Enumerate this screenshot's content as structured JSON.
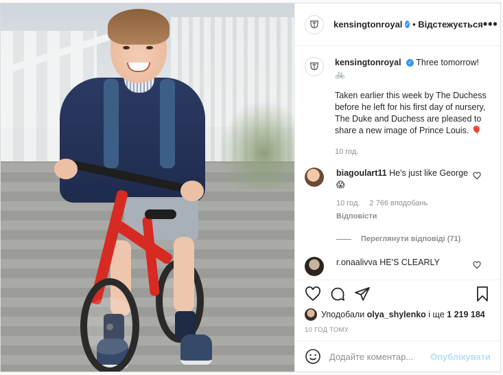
{
  "header": {
    "username": "kensingtonroyal",
    "follow_label": "• Відстежується",
    "more": "•••",
    "avatar_icon": "crest-icon"
  },
  "post": {
    "username": "kensingtonroyal",
    "first_line": "Three tomorrow!",
    "first_emoji": "🚲",
    "caption": "Taken earlier this week by The Duchess before he left for his first day of nursery, The Duke and Duchess are pleased to share a new image of Prince Louis. 🎈",
    "time": "10 год."
  },
  "comments": [
    {
      "username": "biagoulart11",
      "text": "He's just like George",
      "emoji": "😱",
      "time": "10 год.",
      "likes": "2 766 вподобань",
      "reply": "Відповісти",
      "view_replies": "Переглянути відповіді (71)"
    },
    {
      "username": "r.onaalivva",
      "text": "HE'S CLEARLY"
    }
  ],
  "likes": {
    "prefix": "Уподобали",
    "user": "olya_shylenko",
    "suffix": "і ще",
    "count": "1 219 184"
  },
  "time_ago": "10 год тому",
  "add_comment": {
    "placeholder": "Додайте коментар...",
    "publish": "Опублікувати"
  },
  "colors": {
    "verified": "#3897f0",
    "publish_disabled": "#b2dffc",
    "bike_red": "#d72a22"
  }
}
